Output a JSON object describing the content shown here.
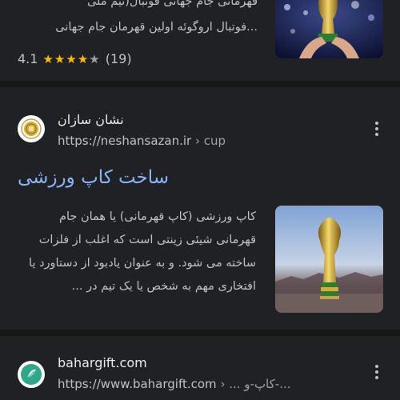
{
  "result1": {
    "snippet_line1": "قهرمانی جام جهانی فوتبال(تیم ملی",
    "snippet_line2": "...فوتبال اروگوئه اولین قهرمان جام جهانی",
    "rating_value": "4.1",
    "rating_stars": 4,
    "rating_count": "(19)"
  },
  "result2": {
    "site_name": "نشان سازان",
    "url": "https://neshansazan.ir",
    "url_crumb": " › cup",
    "title": "ساخت کاپ ورزشی",
    "snippet": "کاپ ورزشی (کاپ قهرمانی) یا همان جام قهرمانی شیئی زینتی است که اغلب از فلزات ساخته می شود. و به عنوان یادبود از دستاورد یا افتخاری مهم به شخص یا یک تیم در ..."
  },
  "result3": {
    "site_name": "bahargift.com",
    "url": "https://www.bahargift.com",
    "url_crumb": " › ... کاپ-و-..."
  },
  "colors": {
    "background": "#202124",
    "title_link": "#8ab4f8",
    "star": "#fbbc04"
  }
}
